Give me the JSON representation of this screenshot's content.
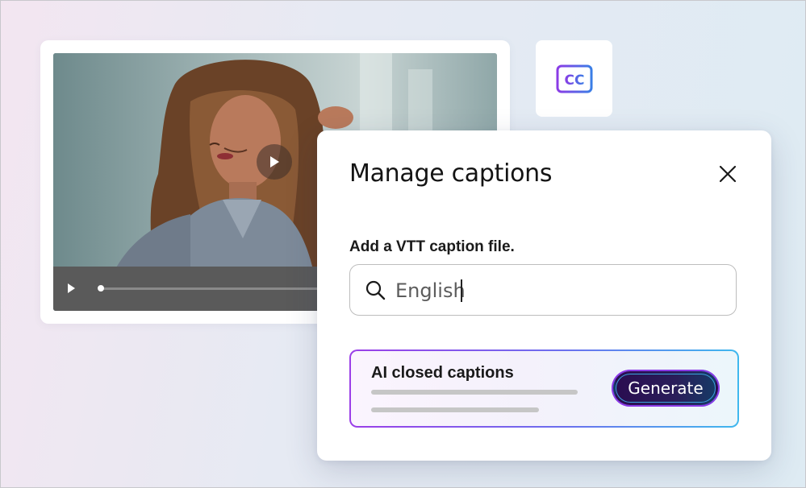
{
  "dialog": {
    "title": "Manage captions",
    "field_label": "Add a VTT caption file.",
    "search": {
      "value": "English"
    },
    "ai": {
      "title": "AI closed captions",
      "button_label": "Generate"
    }
  },
  "cc_tile": {
    "icon": "closed-captions-icon",
    "label": "CC"
  },
  "video": {
    "icons": {
      "play": "play-icon",
      "big_play": "play-overlay-icon"
    },
    "progress": 0.0
  },
  "colors": {
    "accent_purple": "#9b3ee8",
    "accent_blue": "#3fb8ee",
    "button_dark": "#2a0d50"
  }
}
